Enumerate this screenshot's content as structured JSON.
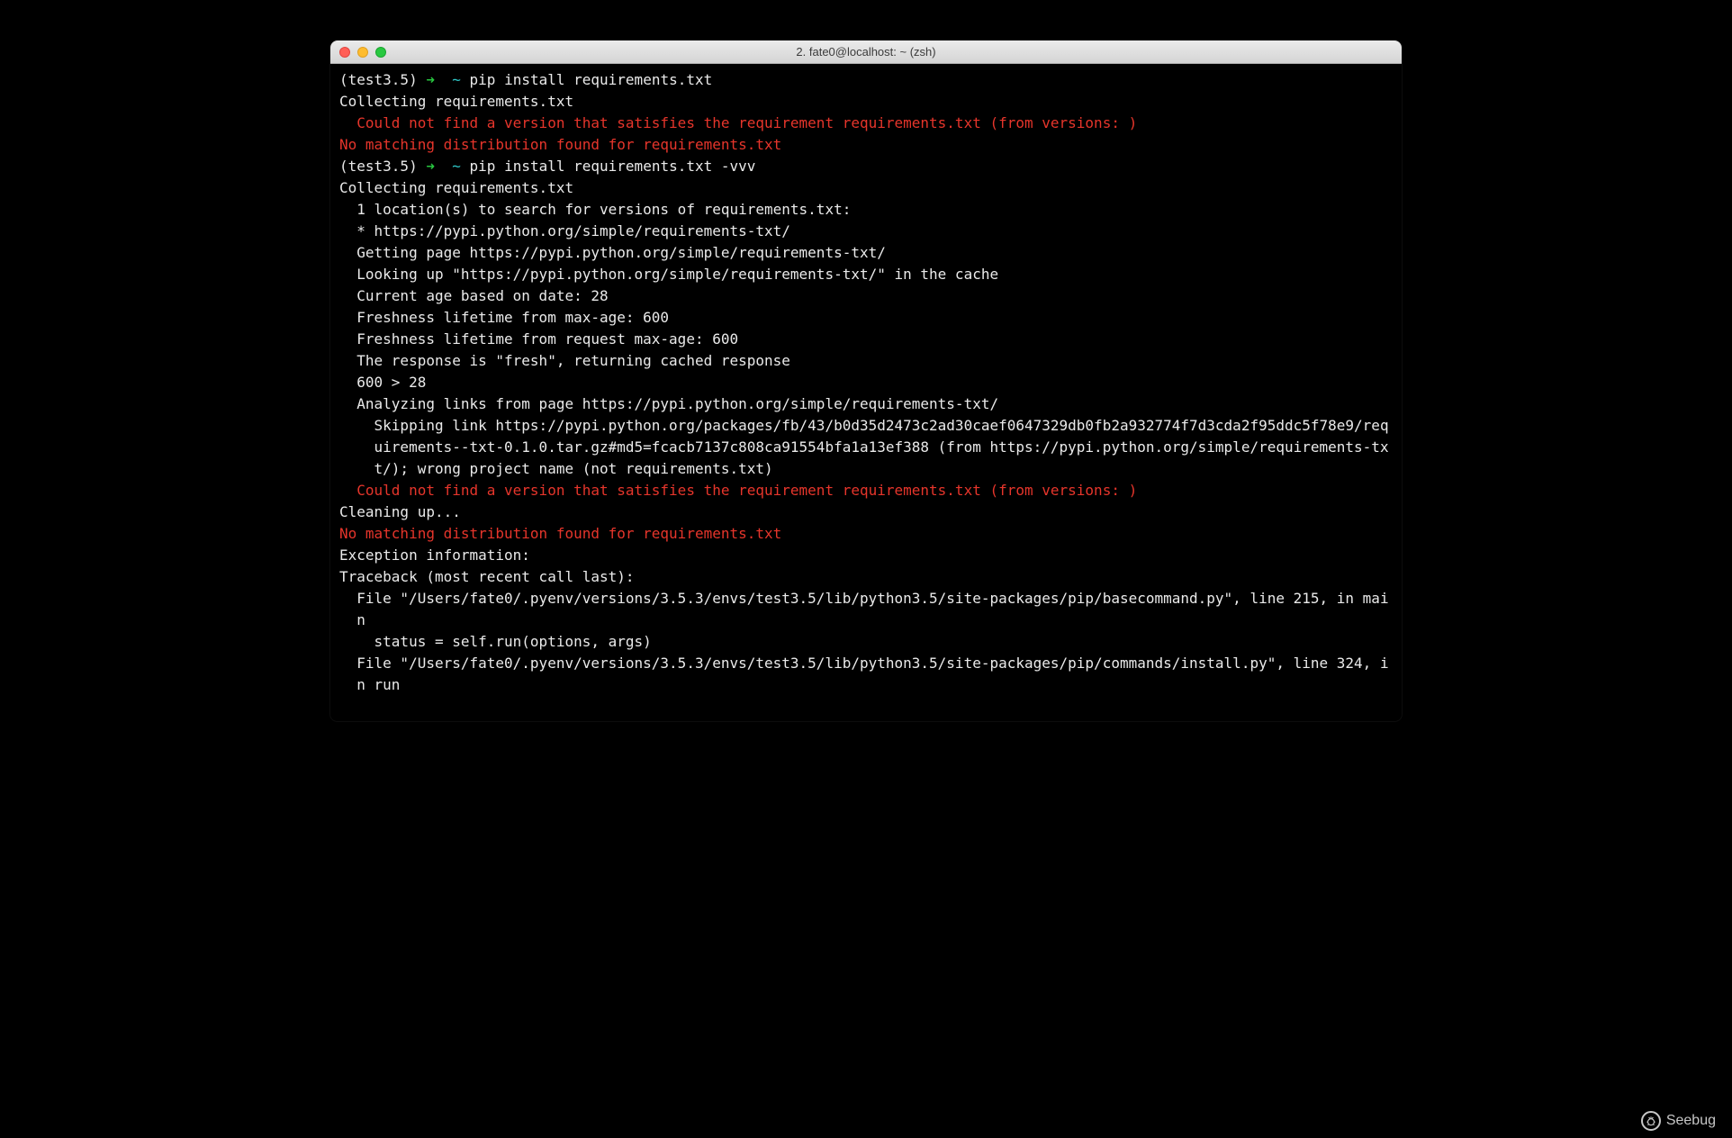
{
  "window": {
    "title": "2. fate0@localhost: ~ (zsh)"
  },
  "prompt": {
    "venv": "(test3.5)",
    "arrow": "➜",
    "cwd": "~",
    "cmd1": "pip install requirements.txt",
    "cmd2": "pip install requirements.txt -vvv"
  },
  "out": {
    "collecting": "Collecting requirements.txt",
    "err_nover": "Could not find a version that satisfies the requirement requirements.txt (from versions: )",
    "err_nomatch": "No matching distribution found for requirements.txt",
    "loc": "1 location(s) to search for versions of requirements.txt:",
    "star_url": "* https://pypi.python.org/simple/requirements-txt/",
    "getting": "Getting page https://pypi.python.org/simple/requirements-txt/",
    "lookup": "Looking up \"https://pypi.python.org/simple/requirements-txt/\" in the cache",
    "age": "Current age based on date: 28",
    "fresh1": "Freshness lifetime from max-age: 600",
    "fresh2": "Freshness lifetime from request max-age: 600",
    "freshresp": "The response is \"fresh\", returning cached response",
    "gt": "600 > 28",
    "analyzing": "Analyzing links from page https://pypi.python.org/simple/requirements-txt/",
    "skipping": "Skipping link https://pypi.python.org/packages/fb/43/b0d35d2473c2ad30caef0647329db0fb2a932774f7d3cda2f95ddc5f78e9/requirements--txt-0.1.0.tar.gz#md5=fcacb7137c808ca91554bfa1a13ef388 (from https://pypi.python.org/simple/requirements-txt/); wrong project name (not requirements.txt)",
    "cleaning": "Cleaning up...",
    "excinfo": "Exception information:",
    "traceback": "Traceback (most recent call last):",
    "file1": "File \"/Users/fate0/.pyenv/versions/3.5.3/envs/test3.5/lib/python3.5/site-packages/pip/basecommand.py\", line 215, in main",
    "status": "status = self.run(options, args)",
    "file2": "File \"/Users/fate0/.pyenv/versions/3.5.3/envs/test3.5/lib/python3.5/site-packages/pip/commands/install.py\", line 324, in run"
  },
  "watermark": {
    "text": "Seebug",
    "icon": "🐞"
  }
}
